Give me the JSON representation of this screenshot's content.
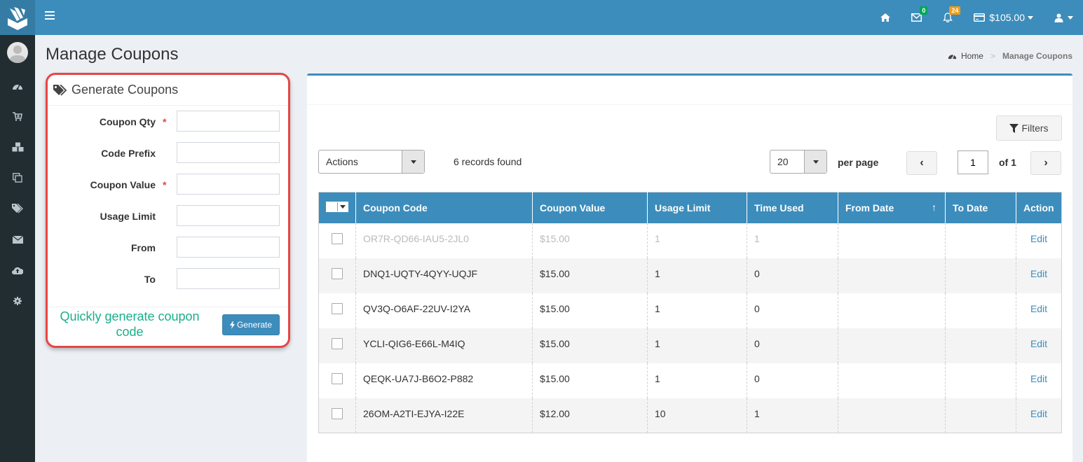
{
  "topbar": {
    "mail_badge": "0",
    "notification_badge": "24",
    "balance": "$105.00",
    "colors": {
      "primary": "#3c8dbc",
      "sidebar": "#222d32",
      "badge_green": "#00a65a",
      "badge_orange": "#f39c12"
    }
  },
  "sidebar": {
    "items": [
      {
        "icon": "dashboard-icon"
      },
      {
        "icon": "cart-plus-icon"
      },
      {
        "icon": "cubes-icon"
      },
      {
        "icon": "copy-icon"
      },
      {
        "icon": "tags-icon"
      },
      {
        "icon": "envelope-icon"
      },
      {
        "icon": "cloud-upload-icon"
      },
      {
        "icon": "gear-icon"
      }
    ]
  },
  "page": {
    "title": "Manage Coupons",
    "breadcrumb": {
      "home": "Home",
      "separator": ">",
      "current": "Manage Coupons"
    }
  },
  "generate_panel": {
    "title": "Generate Coupons",
    "fields": [
      {
        "label": "Coupon Qty",
        "required": true,
        "value": ""
      },
      {
        "label": "Code Prefix",
        "required": false,
        "value": ""
      },
      {
        "label": "Coupon Value",
        "required": true,
        "value": ""
      },
      {
        "label": "Usage Limit",
        "required": false,
        "value": ""
      },
      {
        "label": "From",
        "required": false,
        "value": ""
      },
      {
        "label": "To",
        "required": false,
        "value": ""
      }
    ],
    "required_mark": "*",
    "annotation": "Quickly generate coupon code",
    "generate_button": "Generate"
  },
  "list": {
    "filters_button": "Filters",
    "actions_select": "Actions",
    "records_found": "6 records found",
    "per_page_value": "20",
    "per_page_label": "per page",
    "prev": "‹",
    "next": "›",
    "current_page": "1",
    "of_total": "of 1",
    "columns": [
      "Coupon Code",
      "Coupon Value",
      "Usage Limit",
      "Time Used",
      "From Date",
      "To Date",
      "Action"
    ],
    "sort_indicator": "↑",
    "rows": [
      {
        "code": "OR7R-QD66-IAU5-2JL0",
        "value": "$15.00",
        "limit": "1",
        "used": "1",
        "from": "",
        "to": "",
        "action": "Edit",
        "disabled": true
      },
      {
        "code": "DNQ1-UQTY-4QYY-UQJF",
        "value": "$15.00",
        "limit": "1",
        "used": "0",
        "from": "",
        "to": "",
        "action": "Edit",
        "disabled": false
      },
      {
        "code": "QV3Q-O6AF-22UV-I2YA",
        "value": "$15.00",
        "limit": "1",
        "used": "0",
        "from": "",
        "to": "",
        "action": "Edit",
        "disabled": false
      },
      {
        "code": "YCLI-QIG6-E66L-M4IQ",
        "value": "$15.00",
        "limit": "1",
        "used": "0",
        "from": "",
        "to": "",
        "action": "Edit",
        "disabled": false
      },
      {
        "code": "QEQK-UA7J-B6O2-P882",
        "value": "$15.00",
        "limit": "1",
        "used": "0",
        "from": "",
        "to": "",
        "action": "Edit",
        "disabled": false
      },
      {
        "code": "26OM-A2TI-EJYA-I22E",
        "value": "$12.00",
        "limit": "10",
        "used": "1",
        "from": "",
        "to": "",
        "action": "Edit",
        "disabled": false
      }
    ]
  }
}
